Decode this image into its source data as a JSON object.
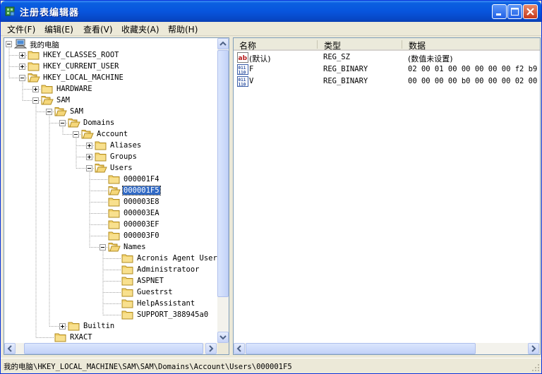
{
  "window": {
    "title": "注册表编辑器"
  },
  "menu": [
    {
      "label": "文件(F)"
    },
    {
      "label": "编辑(E)"
    },
    {
      "label": "查看(V)"
    },
    {
      "label": "收藏夹(A)"
    },
    {
      "label": "帮助(H)"
    }
  ],
  "tree": [
    {
      "label": "我的电脑",
      "level": 0,
      "expander": "minus",
      "icon": "computer-icon"
    },
    {
      "label": "HKEY_CLASSES_ROOT",
      "level": 1,
      "expander": "plus",
      "icon": "folder-icon"
    },
    {
      "label": "HKEY_CURRENT_USER",
      "level": 1,
      "expander": "plus",
      "icon": "folder-icon"
    },
    {
      "label": "HKEY_LOCAL_MACHINE",
      "level": 1,
      "expander": "minus",
      "icon": "folder-open-icon"
    },
    {
      "label": "HARDWARE",
      "level": 2,
      "expander": "plus",
      "icon": "folder-icon"
    },
    {
      "label": "SAM",
      "level": 2,
      "expander": "minus",
      "icon": "folder-open-icon"
    },
    {
      "label": "SAM",
      "level": 3,
      "expander": "minus",
      "icon": "folder-open-icon"
    },
    {
      "label": "Domains",
      "level": 4,
      "expander": "minus",
      "icon": "folder-open-icon"
    },
    {
      "label": "Account",
      "level": 5,
      "expander": "minus",
      "icon": "folder-open-icon"
    },
    {
      "label": "Aliases",
      "level": 6,
      "expander": "plus",
      "icon": "folder-icon"
    },
    {
      "label": "Groups",
      "level": 6,
      "expander": "plus",
      "icon": "folder-icon"
    },
    {
      "label": "Users",
      "level": 6,
      "expander": "minus",
      "icon": "folder-open-icon"
    },
    {
      "label": "000001F4",
      "level": 7,
      "expander": "none",
      "icon": "folder-icon"
    },
    {
      "label": "000001F5",
      "level": 7,
      "expander": "none",
      "icon": "folder-open-icon",
      "selected": true
    },
    {
      "label": "000003E8",
      "level": 7,
      "expander": "none",
      "icon": "folder-icon"
    },
    {
      "label": "000003EA",
      "level": 7,
      "expander": "none",
      "icon": "folder-icon"
    },
    {
      "label": "000003EF",
      "level": 7,
      "expander": "none",
      "icon": "folder-icon"
    },
    {
      "label": "000003F0",
      "level": 7,
      "expander": "none",
      "icon": "folder-icon"
    },
    {
      "label": "Names",
      "level": 7,
      "expander": "minus",
      "icon": "folder-open-icon"
    },
    {
      "label": "Acronis Agent User",
      "level": 8,
      "expander": "none",
      "icon": "folder-icon"
    },
    {
      "label": "Administratoor",
      "level": 8,
      "expander": "none",
      "icon": "folder-icon"
    },
    {
      "label": "ASPNET",
      "level": 8,
      "expander": "none",
      "icon": "folder-icon"
    },
    {
      "label": "Guestrst",
      "level": 8,
      "expander": "none",
      "icon": "folder-icon"
    },
    {
      "label": "HelpAssistant",
      "level": 8,
      "expander": "none",
      "icon": "folder-icon"
    },
    {
      "label": "SUPPORT_388945a0",
      "level": 8,
      "expander": "none",
      "icon": "folder-icon"
    },
    {
      "label": "Builtin",
      "level": 4,
      "expander": "plus",
      "icon": "folder-icon"
    },
    {
      "label": "RXACT",
      "level": 3,
      "expander": "none",
      "icon": "folder-icon"
    }
  ],
  "list": {
    "columns": [
      "名称",
      "类型",
      "数据"
    ],
    "rows": [
      {
        "name": "(默认)",
        "type": "REG_SZ",
        "data": "(数值未设置)",
        "icon": "string-value-icon"
      },
      {
        "name": "F",
        "type": "REG_BINARY",
        "data": "02 00 01 00 00 00 00 00 f2 b9 b",
        "icon": "binary-value-icon"
      },
      {
        "name": "V",
        "type": "REG_BINARY",
        "data": "00 00 00 00 b0 00 00 00 02 00 0",
        "icon": "binary-value-icon"
      }
    ]
  },
  "status": {
    "path": "我的电脑\\HKEY_LOCAL_MACHINE\\SAM\\SAM\\Domains\\Account\\Users\\000001F5"
  },
  "colors": {
    "titlebar": "#0855dd",
    "selection": "#316ac5",
    "chrome": "#ece9d8"
  }
}
